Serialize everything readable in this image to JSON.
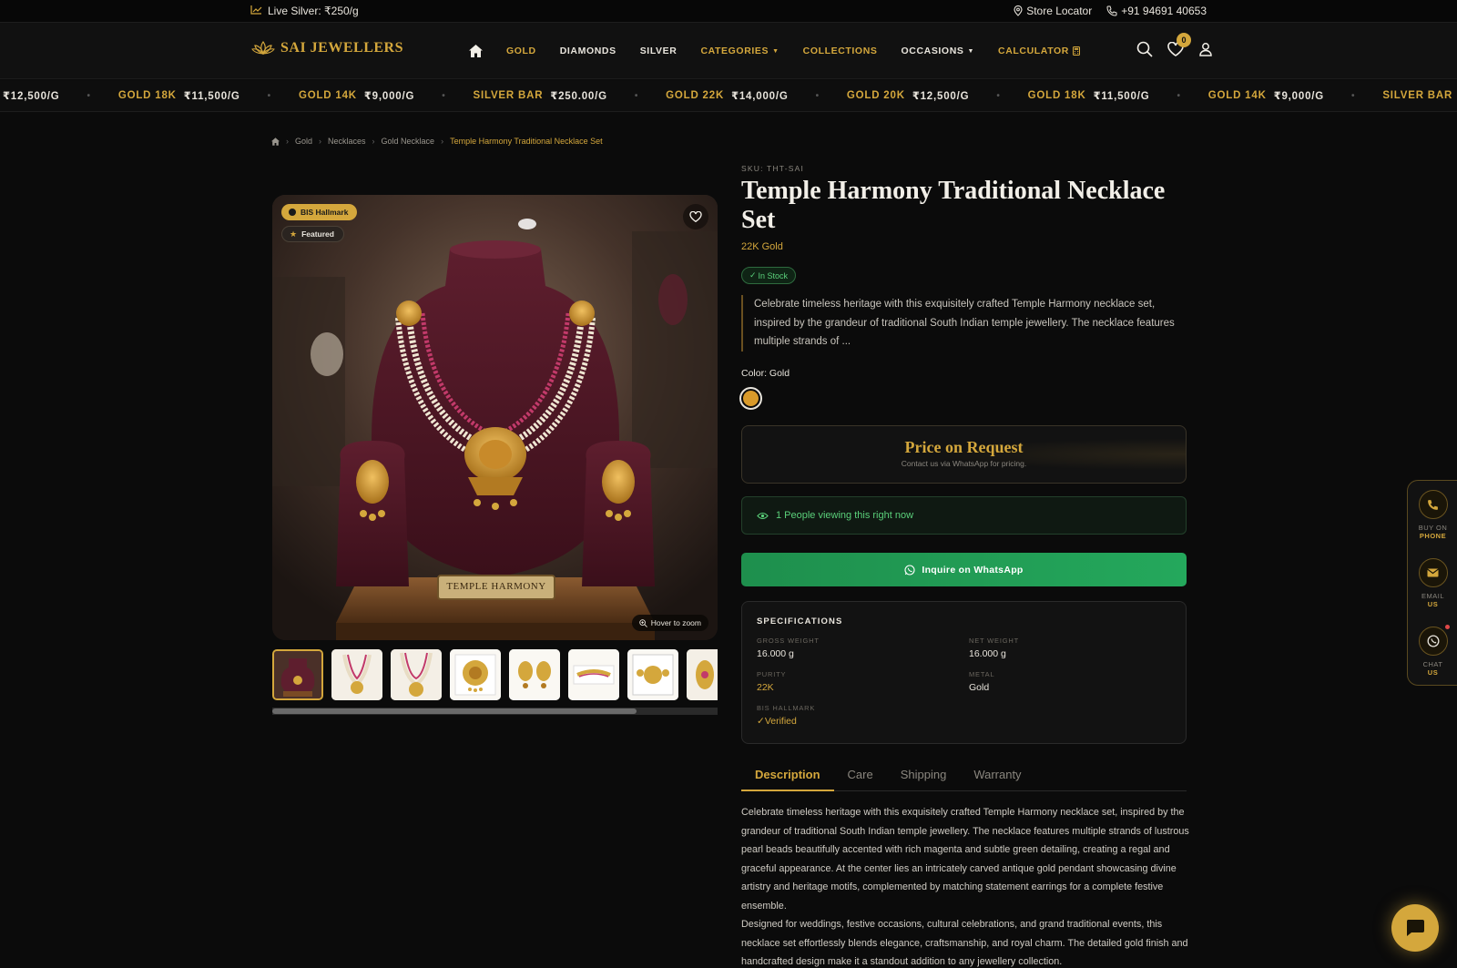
{
  "topbar": {
    "live_rate": "Live Silver: ₹250/g",
    "store_locator": "Store Locator",
    "phone": "+91 94691 40653"
  },
  "nav": {
    "brand": "SAI JEWELLERS",
    "menu": [
      {
        "label": "GOLD"
      },
      {
        "label": "DIAMONDS"
      },
      {
        "label": "SILVER"
      },
      {
        "label": "CATEGORIES"
      },
      {
        "label": "COLLECTIONS"
      },
      {
        "label": "OCCASIONS"
      },
      {
        "label": "CALCULATOR"
      }
    ],
    "wishlist_count": "0"
  },
  "ticker": [
    {
      "name": "",
      "value": "₹12,500/G"
    },
    {
      "name": "GOLD 18K",
      "value": "₹11,500/G"
    },
    {
      "name": "GOLD 14K",
      "value": "₹9,000/G"
    },
    {
      "name": "SILVER BAR",
      "value": "₹250.00/G"
    },
    {
      "name": "GOLD 22K",
      "value": "₹14,000/G"
    },
    {
      "name": "GOLD 20K",
      "value": "₹12,500/G"
    },
    {
      "name": "GOLD 18K",
      "value": "₹11,500/G"
    },
    {
      "name": "GOLD 14K",
      "value": "₹9,000/G"
    },
    {
      "name": "SILVER BAR",
      "value": "₹250.00/G"
    }
  ],
  "breadcrumb": [
    "Gold",
    "Necklaces",
    "Gold Necklace",
    "Temple Harmony Traditional Necklace Set"
  ],
  "gallery": {
    "badge_hallmark": "BIS Hallmark",
    "badge_featured": "Featured",
    "plaque": "TEMPLE HARMONY",
    "hover_hint": "Hover to zoom"
  },
  "product": {
    "sku": "SKU: THT-SAI",
    "title": "Temple Harmony Traditional Necklace Set",
    "karat": "22K Gold",
    "stock": "In Stock",
    "short_description": "Celebrate timeless heritage with this exquisitely crafted Temple Harmony necklace set, inspired by the grandeur of traditional South Indian temple jewellery. The necklace features multiple strands of ...",
    "color_label": "Color: Gold",
    "swatch_color": "#d99a2a",
    "price_title": "Price on Request",
    "price_sub": "Contact us via WhatsApp for pricing.",
    "viewers": "1 People viewing this right now",
    "whatsapp_btn": "Inquire on WhatsApp"
  },
  "specifications": {
    "heading": "SPECIFICATIONS",
    "gross_weight_label": "GROSS WEIGHT",
    "gross_weight": "16.000 g",
    "net_weight_label": "NET WEIGHT",
    "net_weight": "16.000 g",
    "purity_label": "PURITY",
    "purity": "22K",
    "metal_label": "METAL",
    "metal": "Gold",
    "hallmark_label": "BIS HALLMARK",
    "hallmark": "Verified"
  },
  "tabs": [
    "Description",
    "Care",
    "Shipping",
    "Warranty"
  ],
  "description": {
    "p1": "Celebrate timeless heritage with this exquisitely crafted Temple Harmony necklace set, inspired by the grandeur of traditional South Indian temple jewellery. The necklace features multiple strands of lustrous pearl beads beautifully accented with rich magenta and subtle green detailing, creating a regal and graceful appearance. At the center lies an intricately carved antique gold pendant showcasing divine artistry and heritage motifs, complemented by matching statement earrings for a complete festive ensemble.",
    "p2": "Designed for weddings, festive occasions, cultural celebrations, and grand traditional events, this necklace set effortlessly blends elegance, craftsmanship, and royal charm. The detailed gold finish and handcrafted design make it a standout addition to any jewellery collection."
  },
  "floating": {
    "phone_l1": "BUY ON",
    "phone_l2": "PHONE",
    "email_l1": "EMAIL",
    "email_l2": "US",
    "chat_l1": "CHAT",
    "chat_l2": "US"
  },
  "colors": {
    "accent": "#d4a73c",
    "success": "#5ad07a",
    "whatsapp": "#24a85c",
    "background": "#0b0b0b"
  }
}
